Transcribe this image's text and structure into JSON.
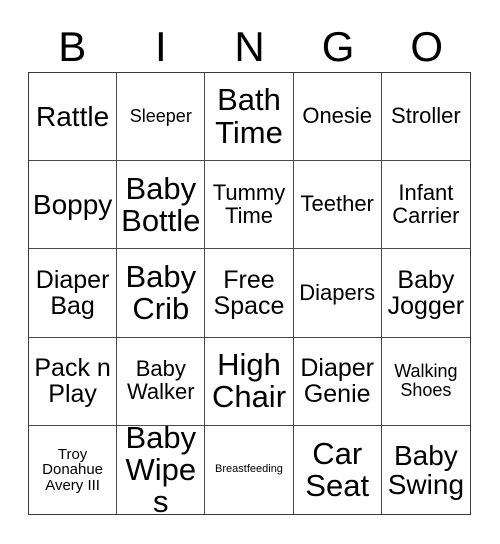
{
  "card": {
    "type": "bingo-card",
    "title": "BINGO",
    "background_color": "#ffffff",
    "text_color": "#000000",
    "border_color": "#4a4a4a",
    "columns": 5,
    "rows": 5
  },
  "header": {
    "letters": [
      "B",
      "I",
      "N",
      "G",
      "O"
    ]
  },
  "grid": {
    "rows": [
      {
        "cells": [
          {
            "text": "Rattle",
            "size": "xl"
          },
          {
            "text": "Sleeper",
            "size": "sm"
          },
          {
            "text": "Bath Time",
            "size": "xxl"
          },
          {
            "text": "Onesie",
            "size": "md"
          },
          {
            "text": "Stroller",
            "size": "md"
          }
        ]
      },
      {
        "cells": [
          {
            "text": "Boppy",
            "size": "xl"
          },
          {
            "text": "Baby Bottle",
            "size": "xxl"
          },
          {
            "text": "Tummy Time",
            "size": "md"
          },
          {
            "text": "Teether",
            "size": "md"
          },
          {
            "text": "Infant Carrier",
            "size": "md"
          }
        ]
      },
      {
        "cells": [
          {
            "text": "Diaper Bag",
            "size": "lg"
          },
          {
            "text": "Baby Crib",
            "size": "xxl"
          },
          {
            "text": "Free Space",
            "size": "lg"
          },
          {
            "text": "Diapers",
            "size": "md"
          },
          {
            "text": "Baby Jogger",
            "size": "lg"
          }
        ]
      },
      {
        "cells": [
          {
            "text": "Pack n Play",
            "size": "lg"
          },
          {
            "text": "Baby Walker",
            "size": "md"
          },
          {
            "text": "High Chair",
            "size": "xxl"
          },
          {
            "text": "Diaper Genie",
            "size": "lg"
          },
          {
            "text": "Walking Shoes",
            "size": "sm"
          }
        ]
      },
      {
        "cells": [
          {
            "text": "Troy Donahue Avery III",
            "size": "xs"
          },
          {
            "text": "Baby Wipes",
            "size": "xxl"
          },
          {
            "text": "Breastfeeding",
            "size": "xxs"
          },
          {
            "text": "Car Seat",
            "size": "xxl"
          },
          {
            "text": "Baby Swing",
            "size": "xl"
          }
        ]
      }
    ]
  }
}
